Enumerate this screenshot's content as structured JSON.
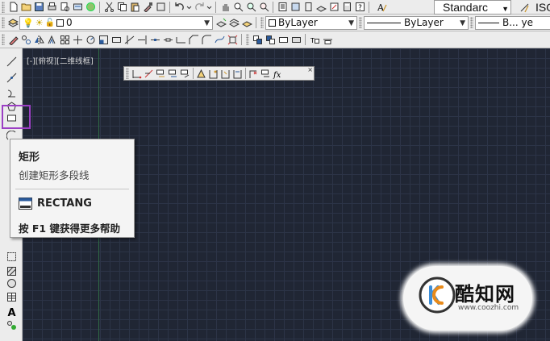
{
  "toolbar_row2": {
    "layer_combo_value": "0",
    "color_combo_value": "ByLayer",
    "linetype_combo_value": "ByLayer",
    "lineweight_combo_value": "B... ye"
  },
  "toolbar_row1": {
    "text_style_value": "Standarc",
    "dim_style_value": "ISO"
  },
  "viewport": {
    "label": "[-][俯视][二维线框]"
  },
  "tooltip": {
    "title": "矩形",
    "description": "创建矩形多段线",
    "command": "RECTANG",
    "help_hint": "按 F1 键获得更多帮助"
  },
  "watermark": {
    "name": "酷知网",
    "url": "www.coozhi.com"
  },
  "floating_toolbar": {
    "close_glyph": "×"
  },
  "colors": {
    "canvas_bg": "#202634",
    "highlight": "#9b3fc4",
    "toolbar_bg": "#ececec"
  }
}
